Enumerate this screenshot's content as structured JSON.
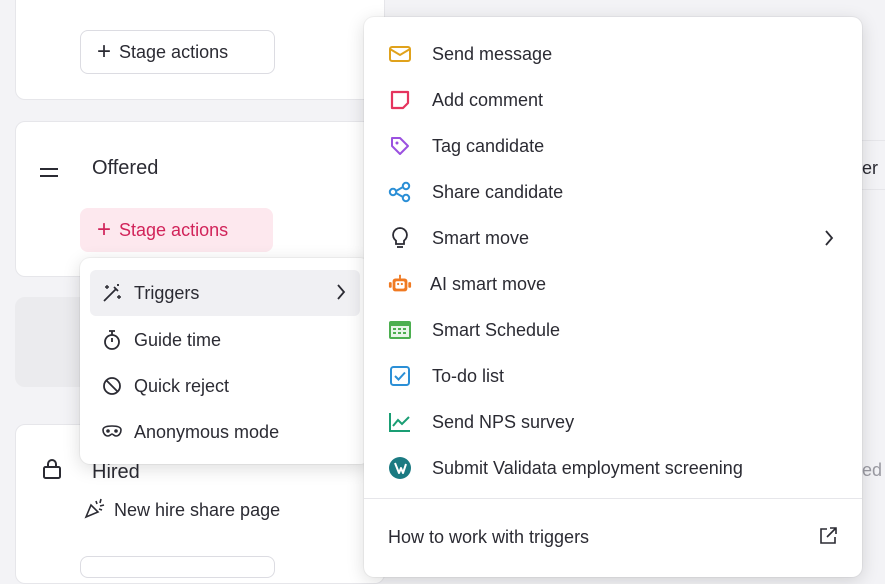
{
  "board": {
    "stage_actions_label": "Stage actions",
    "offered_label": "Offered",
    "hired_label": "Hired",
    "new_hire_share_label": "New hire share page",
    "right_edge_text_1": "er",
    "right_edge_text_2": "ed"
  },
  "left_menu": {
    "items": [
      {
        "label": "Triggers",
        "icon": "magic-wand-icon",
        "has_submenu": true
      },
      {
        "label": "Guide time",
        "icon": "stopwatch-icon"
      },
      {
        "label": "Quick reject",
        "icon": "prohibit-icon"
      },
      {
        "label": "Anonymous mode",
        "icon": "mask-icon"
      }
    ]
  },
  "trigger_menu": {
    "items": [
      {
        "label": "Send message",
        "icon": "envelope-icon"
      },
      {
        "label": "Add comment",
        "icon": "comment-icon"
      },
      {
        "label": "Tag candidate",
        "icon": "tag-icon"
      },
      {
        "label": "Share candidate",
        "icon": "share-icon"
      },
      {
        "label": "Smart move",
        "icon": "lightbulb-icon",
        "has_submenu": true
      },
      {
        "label": "AI smart move",
        "icon": "robot-icon"
      },
      {
        "label": "Smart Schedule",
        "icon": "calendar-icon"
      },
      {
        "label": "To-do list",
        "icon": "checkbox-icon"
      },
      {
        "label": "Send NPS survey",
        "icon": "chart-line-icon"
      },
      {
        "label": "Submit Validata employment screening",
        "icon": "validata-logo-icon"
      }
    ],
    "footer_link": "How to work with triggers"
  },
  "colors": {
    "accent_pink": "#d1245a",
    "accent_pink_bg": "#fde8ee",
    "envelope": "#e0a21c",
    "comment": "#e5345e",
    "tag": "#9b51e0",
    "share": "#2b8fd6",
    "robot": "#f07a22",
    "calendar": "#4caf50",
    "checkbox": "#2b8fd6",
    "chart": "#1a9e74",
    "validata": "#1b7a82"
  }
}
